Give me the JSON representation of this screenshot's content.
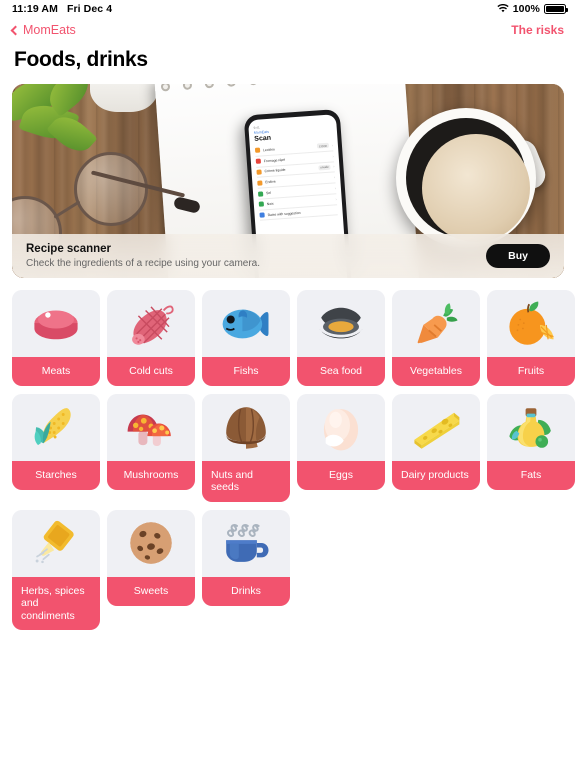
{
  "status_bar": {
    "time": "11:19 AM",
    "date": "Fri Dec 4",
    "battery_percent": "100%",
    "wifi_icon": "wifi-icon",
    "battery_icon": "battery-icon"
  },
  "nav": {
    "back_label": "MomEats",
    "back_icon": "chevron-left-icon",
    "right_link": "The risks"
  },
  "page_title": "Foods, drinks",
  "banner": {
    "title": "Recipe scanner",
    "subtitle": "Check the ingredients of a recipe using your camera.",
    "buy_label": "Buy",
    "phone": {
      "status_time": "9:41",
      "back_label": "MomEats",
      "title": "Scan",
      "rows": [
        {
          "label": "Lecithin",
          "tag": "COOK",
          "color": "#f3992b"
        },
        {
          "label": "Fromage râpé",
          "tag": "",
          "color": "#e8453c"
        },
        {
          "label": "Crème liquide",
          "tag": "unsafe",
          "color": "#f3992b"
        },
        {
          "label": "Endive",
          "tag": "",
          "color": "#f3992b"
        },
        {
          "label": "Sel",
          "tag": "",
          "color": "#34a853"
        },
        {
          "label": "Noix",
          "tag": "",
          "color": "#34a853"
        },
        {
          "label": "Raise with suggestion",
          "tag": "",
          "color": "#3f7fe0"
        }
      ]
    }
  },
  "colors": {
    "accent_pink": "#f2536e",
    "tile_bg": "#eff0f4",
    "page_bg": "#ffffff",
    "buy_button_bg": "#101010"
  },
  "categories": [
    {
      "label": "Meats",
      "icon": "meat-icon",
      "multiline": false
    },
    {
      "label": "Cold cuts",
      "icon": "sausage-icon",
      "multiline": false
    },
    {
      "label": "Fishs",
      "icon": "fish-icon",
      "multiline": false
    },
    {
      "label": "Sea food",
      "icon": "mussel-icon",
      "multiline": false
    },
    {
      "label": "Vegetables",
      "icon": "carrot-icon",
      "multiline": false
    },
    {
      "label": "Fruits",
      "icon": "orange-icon",
      "multiline": false
    },
    {
      "label": "Starches",
      "icon": "corn-icon",
      "multiline": false
    },
    {
      "label": "Mushrooms",
      "icon": "mushroom-icon",
      "multiline": false
    },
    {
      "label": "Nuts and seeds",
      "icon": "chestnut-icon",
      "multiline": true
    },
    {
      "label": "Eggs",
      "icon": "egg-icon",
      "multiline": false
    },
    {
      "label": "Dairy products",
      "icon": "cheese-icon",
      "multiline": true
    },
    {
      "label": "Fats",
      "icon": "oil-bottle-icon",
      "multiline": false
    },
    {
      "label": "Herbs, spices and condiments",
      "icon": "spice-tube-icon",
      "multiline": true
    },
    {
      "label": "Sweets",
      "icon": "cookie-icon",
      "multiline": false
    },
    {
      "label": "Drinks",
      "icon": "hot-cup-icon",
      "multiline": false
    }
  ]
}
